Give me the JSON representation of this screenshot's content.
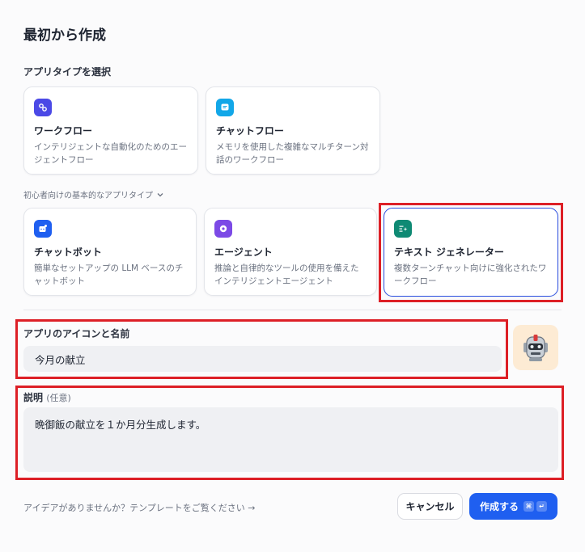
{
  "dialog": {
    "title": "最初から作成",
    "app_type_label": "アプリタイプを選択",
    "basic_label": "初心者向けの基本的なアプリタイプ"
  },
  "app_types": [
    {
      "name": "ワークフロー",
      "desc": "インテリジェントな自動化のためのエージェントフロー",
      "icon": "workflow-icon",
      "color": "#4b49e6"
    },
    {
      "name": "チャットフロー",
      "desc": "メモリを使用した複雑なマルチターン対話のワークフロー",
      "icon": "chatflow-icon",
      "color": "#12a7e8"
    }
  ],
  "basic_types": [
    {
      "name": "チャットボット",
      "desc": "簡単なセットアップの LLM ベースのチャットボット",
      "icon": "chatbot-icon",
      "color": "#1f5ff0"
    },
    {
      "name": "エージェント",
      "desc": "推論と自律的なツールの使用を備えたインテリジェントエージェント",
      "icon": "agent-icon",
      "color": "#7c4ae6"
    },
    {
      "name": "テキスト ジェネレーター",
      "desc": "複数ターンチャット向けに強化されたワークフロー",
      "icon": "text-generator-icon",
      "color": "#0f8a74"
    }
  ],
  "app_name": {
    "label": "アプリのアイコンと名前",
    "value": "今月の献立"
  },
  "description": {
    "label": "説明",
    "optional": "(任意)",
    "value": "晩御飯の献立を１か月分生成します。"
  },
  "footer": {
    "template_link": "アイデアがありませんか？テンプレートをご覧ください →",
    "cancel": "キャンセル",
    "create": "作成する",
    "kbd_cmd": "⌘",
    "kbd_enter": "↵"
  },
  "colors": {
    "accent": "#1f5ff0",
    "highlight": "#dd1f26",
    "avatar_bg": "#fdebd4"
  }
}
